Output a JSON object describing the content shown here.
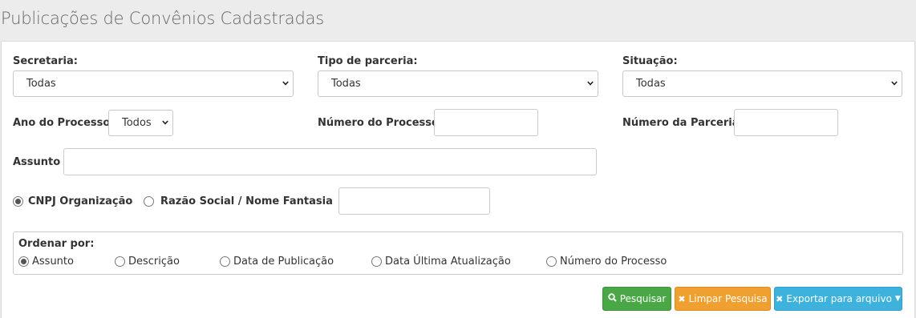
{
  "page": {
    "title": "Publicações de Convênios Cadastradas"
  },
  "filters": {
    "secretaria": {
      "label": "Secretaria:",
      "value": "Todas"
    },
    "tipo_parceria": {
      "label": "Tipo de parceria:",
      "value": "Todas"
    },
    "situacao": {
      "label": "Situação:",
      "value": "Todas"
    },
    "ano_processo": {
      "label": "Ano do Processo",
      "value": "Todos"
    },
    "numero_processo": {
      "label": "Número do Processo",
      "value": ""
    },
    "numero_parceria": {
      "label": "Número da Parceria",
      "value": ""
    },
    "assunto": {
      "label": "Assunto",
      "value": ""
    },
    "search_type": {
      "options": [
        "CNPJ Organização",
        "Razão Social / Nome Fantasia"
      ],
      "selected": "CNPJ Organização",
      "value": ""
    }
  },
  "order": {
    "label": "Ordenar por:",
    "options": [
      "Assunto",
      "Descrição",
      "Data de Publicação",
      "Data Última Atualização",
      "Número do Processo"
    ],
    "selected": "Assunto"
  },
  "buttons": {
    "search": "Pesquisar",
    "clear": "Limpar Pesquisa",
    "export": "Exportar para arquivo"
  },
  "colors": {
    "search_button": "#4aa745",
    "clear_button": "#f0a030",
    "export_button": "#3cb2dc"
  }
}
